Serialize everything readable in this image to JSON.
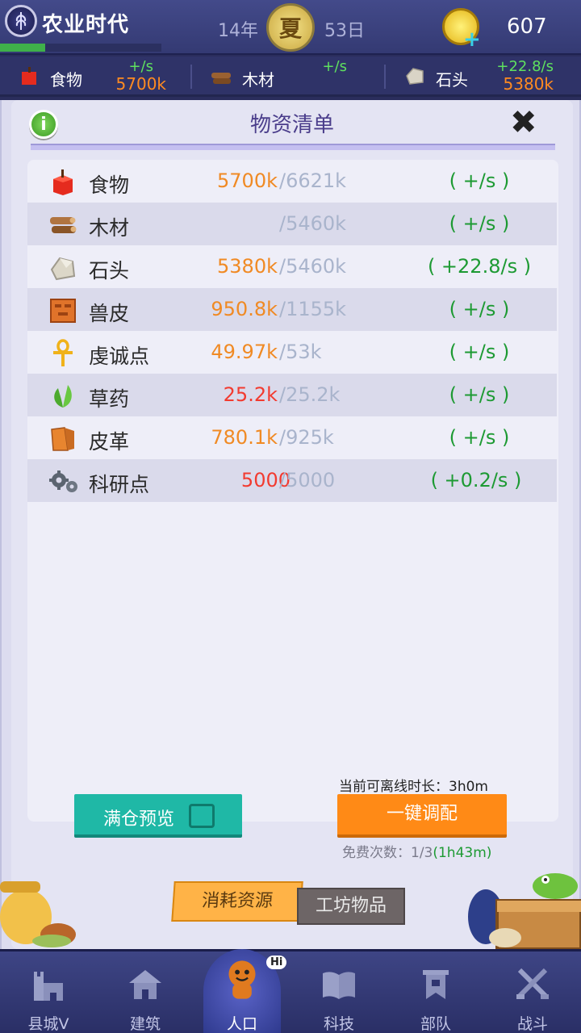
{
  "header": {
    "era_title": "农业时代",
    "era_progress": 0.28,
    "year": "14年",
    "season": "夏",
    "day": "53日",
    "coins": "607"
  },
  "resource_strip": [
    {
      "name": "食物",
      "rate": "+/s",
      "amount": "5700k",
      "icon": "food-icon"
    },
    {
      "name": "木材",
      "rate": "+/s",
      "amount": "",
      "icon": "wood-icon"
    },
    {
      "name": "石头",
      "rate": "+22.8/s",
      "amount": "5380k",
      "icon": "stone-icon"
    }
  ],
  "panel": {
    "title": "物资清单",
    "info_glyph": "i",
    "close_glyph": "✖",
    "rows": [
      {
        "name": "食物",
        "amount": "5700k",
        "cap": "/6621k",
        "rate": "( +/s )",
        "amount_color": "orange",
        "icon": "food-icon"
      },
      {
        "name": "木材",
        "amount": "",
        "cap": "/5460k",
        "rate": "( +/s )",
        "amount_color": "orange",
        "icon": "wood-icon"
      },
      {
        "name": "石头",
        "amount": "5380k",
        "cap": "/5460k",
        "rate": "( +22.8/s )",
        "amount_color": "orange",
        "icon": "stone-icon"
      },
      {
        "name": "兽皮",
        "amount": "950.8k",
        "cap": "/1155k",
        "rate": "( +/s )",
        "amount_color": "orange",
        "icon": "hide-icon"
      },
      {
        "name": "虔诚点",
        "amount": "49.97k",
        "cap": "/53k",
        "rate": "( +/s )",
        "amount_color": "orange",
        "icon": "ankh-icon"
      },
      {
        "name": "草药",
        "amount": "25.2k",
        "cap": "/25.2k",
        "rate": "( +/s )",
        "amount_color": "red",
        "icon": "herb-icon"
      },
      {
        "name": "皮革",
        "amount": "780.1k",
        "cap": "/925k",
        "rate": "( +/s )",
        "amount_color": "orange",
        "icon": "leather-icon"
      },
      {
        "name": "科研点",
        "amount": "5000",
        "cap": "/5000",
        "rate": "( +0.2/s )",
        "amount_color": "red",
        "icon": "gears-icon"
      }
    ],
    "offline_label": "当前可离线时长：3h0m",
    "full_preview_label": "满仓预览",
    "one_key_label": "一键调配",
    "free_times_label": "免费次数：1/3",
    "free_times_timer": "(1h43m)"
  },
  "tabs": {
    "consume": "消耗资源",
    "workshop": "工坊物品"
  },
  "nav": [
    {
      "label": "县城V",
      "icon": "castle-icon"
    },
    {
      "label": "建筑",
      "icon": "house-icon"
    },
    {
      "label": "人口",
      "icon": "person-icon"
    },
    {
      "label": "科技",
      "icon": "book-icon"
    },
    {
      "label": "部队",
      "icon": "banner-icon"
    },
    {
      "label": "战斗",
      "icon": "swords-icon"
    }
  ],
  "hi_badge": "Hi",
  "colors": {
    "accent_orange": "#ff8a16",
    "accent_teal": "#1fb8a6",
    "rate_green": "#1d9a33",
    "amount_orange": "#f08a24",
    "amount_red": "#f23b30"
  }
}
